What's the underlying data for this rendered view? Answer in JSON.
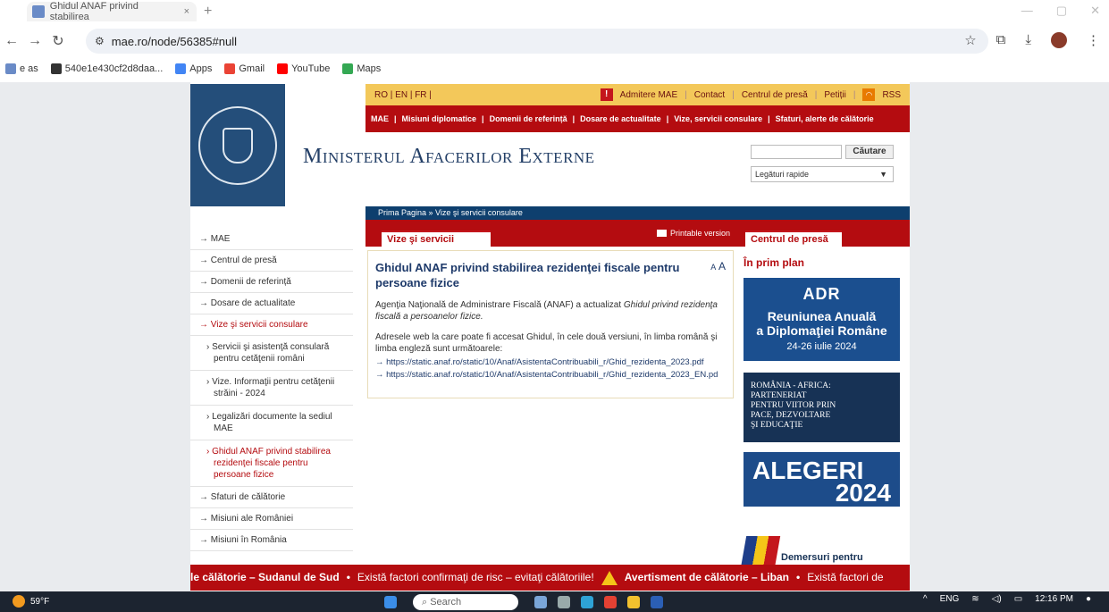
{
  "browser": {
    "tab_title": "Ghidul ANAF privind stabilirea",
    "tab_close": "×",
    "new_tab": "+",
    "url": "mae.ro/node/56385#null",
    "bookmarks": [
      {
        "label": "e as",
        "color": "#6a8bc7"
      },
      {
        "label": "540e1e430cf2d8daa...",
        "color": "#333333"
      },
      {
        "label": "Apps",
        "color": "#4285f4"
      },
      {
        "label": "Gmail",
        "color": "#ea4335"
      },
      {
        "label": "YouTube",
        "color": "#ff0000"
      },
      {
        "label": "Maps",
        "color": "#34a853"
      }
    ]
  },
  "site": {
    "langs": "RO | EN | FR |",
    "top_links": {
      "admitere": "Admitere MAE",
      "contact": "Contact",
      "centrul": "Centrul de presă",
      "petitii": "Petiții",
      "rss": "RSS",
      "sep": "|"
    },
    "main_nav": [
      "MAE",
      "Misiuni diplomatice",
      "Domenii de referință",
      "Dosare de actualitate",
      "Vize, servicii consulare",
      "Sfaturi, alerte de călătorie"
    ],
    "ministry": "Ministerul Afacerilor Externe",
    "search_button": "Căutare",
    "quick_links": "Legături rapide",
    "breadcrumb": "Prima Pagina  »  Vize şi servicii consulare",
    "section_tab": "Vize şi servicii consulare",
    "printable": "Printable version",
    "right_tab": "Centrul de presă"
  },
  "sidebar": {
    "items": [
      {
        "label": "MAE"
      },
      {
        "label": "Centrul de presă"
      },
      {
        "label": "Domenii de referință"
      },
      {
        "label": "Dosare de actualitate"
      },
      {
        "label": "Vize şi servicii consulare"
      }
    ],
    "subitems": [
      {
        "label": "Servicii şi asistenţă consulară pentru cetăţenii români"
      },
      {
        "label": "Vize. Informaţii pentru cetăţenii străini - 2024"
      },
      {
        "label": "Legalizări documente la sediul MAE"
      },
      {
        "label": "Ghidul ANAF privind stabilirea rezidenţei fiscale pentru persoane fizice"
      }
    ],
    "items_after": [
      {
        "label": "Sfaturi de călătorie"
      },
      {
        "label": "Misiuni ale României"
      },
      {
        "label": "Misiuni în România"
      }
    ]
  },
  "article": {
    "title": "Ghidul ANAF privind stabilirea rezidenţei fiscale pentru persoane fizice",
    "font_small": "A",
    "font_big": "A",
    "p1_normal": "Agenţia Naţională de Administrare Fiscală (ANAF) a actualizat ",
    "p1_italic": "Ghidul privind rezidenţa fiscală a persoanelor fizice.",
    "p2": "Adresele web la care poate fi accesat Ghidul, în cele două versiuni, în limba română şi limba engleză sunt următoarele:",
    "links": [
      "→ https://static.anaf.ro/static/10/Anaf/AsistentaContribuabili_r/Ghid_rezidenta_2023.pdf",
      "→ https://static.anaf.ro/static/10/Anaf/AsistentaContribuabili_r/Ghid_rezidenta_2023_EN.pd"
    ]
  },
  "right": {
    "heading": "În prim plan",
    "banner1": {
      "logo": "ADR",
      "line1": "Reuniunea Anuală",
      "line2": "a Diplomaţiei Române",
      "line3": "24-26 iulie 2024"
    },
    "banner2": {
      "lines": [
        "ROMÂNIA - AFRICA:",
        "PARTENERIAT",
        "PENTRU VIITOR PRIN",
        "PACE, DEZVOLTARE",
        "ŞI EDUCAŢIE"
      ]
    },
    "banner3": {
      "line1": "ALEGERI",
      "line2": "2024"
    },
    "banner4": {
      "text": "Demersuri pentru"
    }
  },
  "ticker": {
    "part1": "le călătorie – Sudanul de Sud",
    "bullet": "•",
    "part2": "Există factori confirmaţi de risc – evitaţi călătoriile!",
    "part3": "Avertisment de călătorie – Liban",
    "part4": "Există factori de"
  },
  "taskbar": {
    "temp": "59°F",
    "search": "Search",
    "lang": "ENG",
    "time": "12:16 PM"
  }
}
